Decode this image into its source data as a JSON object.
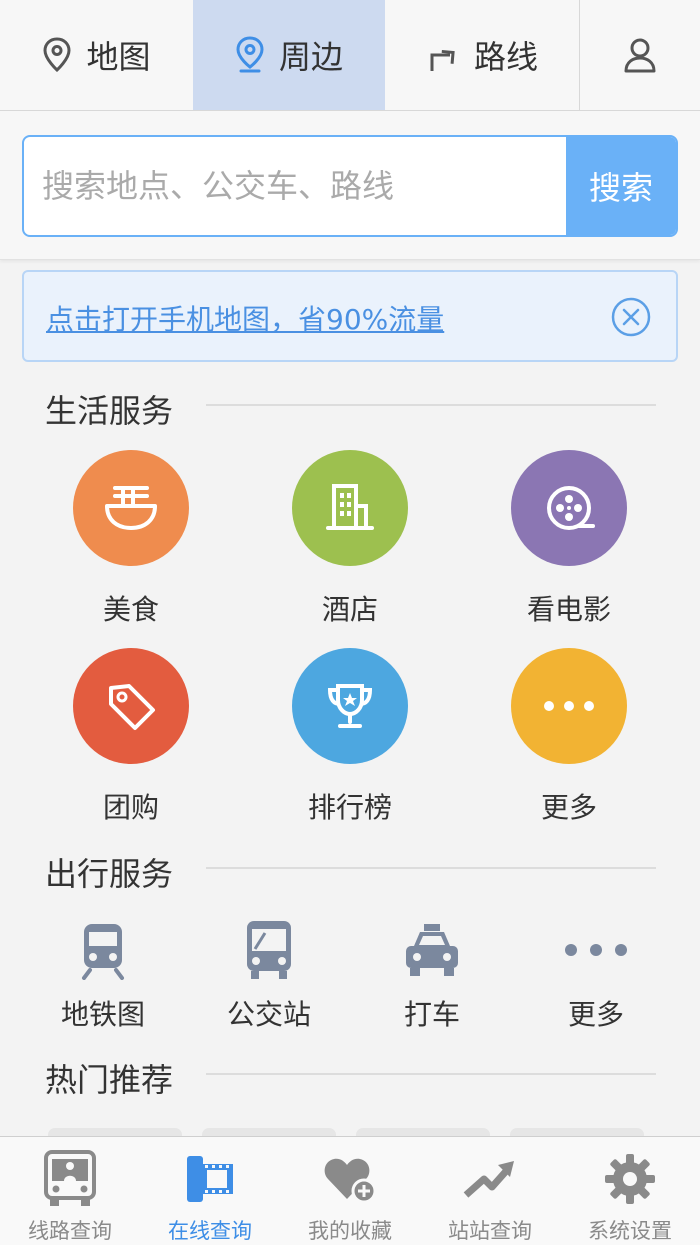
{
  "top_nav": {
    "tabs": [
      {
        "label": "地图",
        "icon": "map-pin-icon"
      },
      {
        "label": "周边",
        "icon": "nearby-pin-icon",
        "active": true
      },
      {
        "label": "路线",
        "icon": "route-turn-icon"
      }
    ],
    "user_icon": "user-icon"
  },
  "search": {
    "placeholder": "搜索地点、公交车、路线",
    "button_label": "搜索"
  },
  "banner": {
    "text": "点击打开手机地图，省90%流量",
    "close_icon": "close-circle-icon"
  },
  "life_services": {
    "title": "生活服务",
    "items": [
      {
        "label": "美食",
        "icon": "noodle-bowl-icon",
        "color": "#ef8c4e"
      },
      {
        "label": "酒店",
        "icon": "hotel-building-icon",
        "color": "#9dc04f"
      },
      {
        "label": "看电影",
        "icon": "film-reel-icon",
        "color": "#8b76b3"
      },
      {
        "label": "团购",
        "icon": "price-tag-icon",
        "color": "#e35c3f"
      },
      {
        "label": "排行榜",
        "icon": "trophy-icon",
        "color": "#4da7e0"
      },
      {
        "label": "更多",
        "icon": "more-dots-icon",
        "color": "#f2b333"
      }
    ]
  },
  "travel_services": {
    "title": "出行服务",
    "items": [
      {
        "label": "地铁图",
        "icon": "subway-icon"
      },
      {
        "label": "公交站",
        "icon": "bus-icon"
      },
      {
        "label": "打车",
        "icon": "taxi-icon"
      },
      {
        "label": "更多",
        "icon": "more-dots-icon"
      }
    ]
  },
  "hot": {
    "title": "热门推荐"
  },
  "bottom_tabs": [
    {
      "label": "线路查询",
      "icon": "bus-front-icon"
    },
    {
      "label": "在线查询",
      "icon": "film-roll-icon",
      "active": true
    },
    {
      "label": "我的收藏",
      "icon": "heart-add-icon"
    },
    {
      "label": "站站查询",
      "icon": "trend-arrow-icon"
    },
    {
      "label": "系统设置",
      "icon": "gear-icon"
    }
  ],
  "colors": {
    "accent": "#3e8ee6",
    "search_button": "#6ab1f7",
    "active_tab_bg": "#cddaf0"
  }
}
